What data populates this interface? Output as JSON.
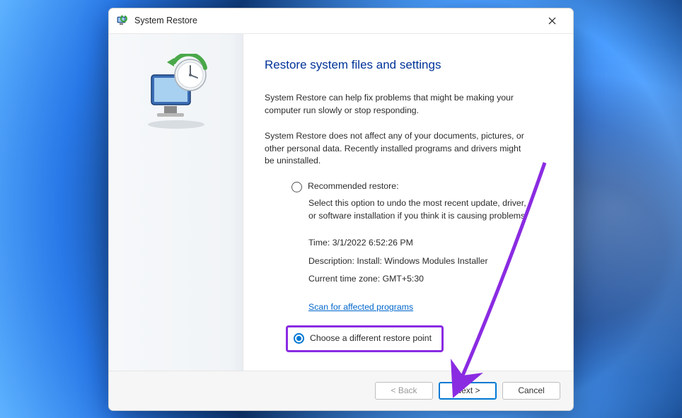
{
  "window": {
    "title": "System Restore"
  },
  "main": {
    "heading": "Restore system files and settings",
    "intro1": "System Restore can help fix problems that might be making your computer run slowly or stop responding.",
    "intro2": "System Restore does not affect any of your documents, pictures, or other personal data. Recently installed programs and drivers might be uninstalled."
  },
  "options": {
    "recommended": {
      "label": "Recommended restore:",
      "desc": "Select this option to undo the most recent update, driver, or software installation if you think it is causing problems.",
      "time_label": "Time: 3/1/2022 6:52:26 PM",
      "desc_label": "Description: Install: Windows Modules Installer",
      "tz_label": "Current time zone: GMT+5:30",
      "scan_link": "Scan for affected programs"
    },
    "different": {
      "label": "Choose a different restore point"
    }
  },
  "buttons": {
    "back": "< Back",
    "next": "Next >",
    "cancel": "Cancel"
  }
}
